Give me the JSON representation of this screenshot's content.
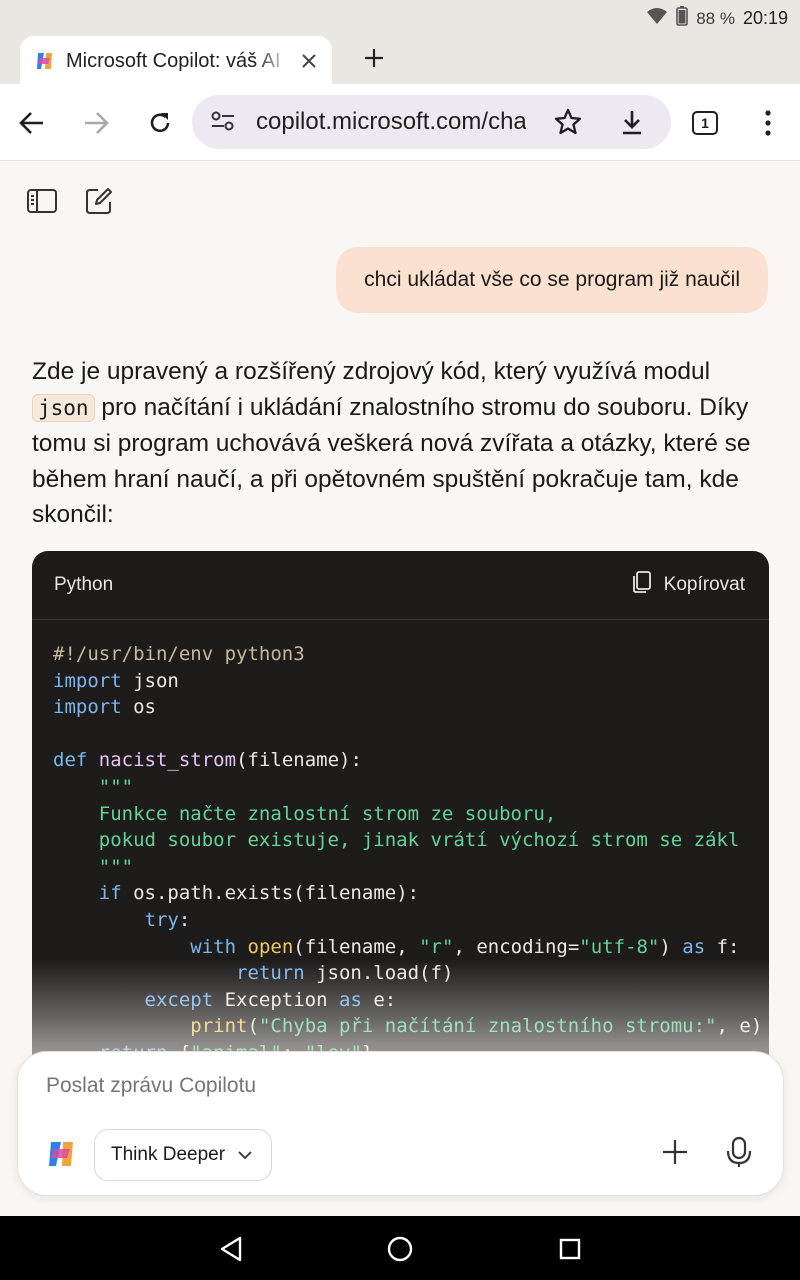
{
  "status_bar": {
    "battery": "88 %",
    "time": "20:19"
  },
  "tab": {
    "title": "Microsoft Copilot: váš AI"
  },
  "toolbar": {
    "url": "copilot.microsoft.com/chats",
    "tab_count": "1"
  },
  "chat": {
    "user_message": "chci ukládat vše co se program již naučil",
    "answer_before_code": "Zde je upravený a rozšířený zdrojový kód, který využívá modul",
    "answer_code_term": "json",
    "answer_after_code": "pro načítání i ukládání znalostního stromu do souboru. Díky tomu si program uchovává veškerá nová zvířata a otázky, které se během hraní naučí, a při opětovném spuštění pokračuje tam, kde skončil:"
  },
  "code_block": {
    "language": "Python",
    "copy_label": "Kopírovat",
    "lines": [
      "#!/usr/bin/env python3",
      "import json",
      "import os",
      "",
      "def nacist_strom(filename):",
      "    \"\"\"",
      "    Funkce načte znalostní strom ze souboru,",
      "    pokud soubor existuje, jinak vrátí výchozí strom se zákl",
      "    \"\"\"",
      "    if os.path.exists(filename):",
      "        try:",
      "            with open(filename, \"r\", encoding=\"utf-8\") as f:",
      "                return json.load(f)",
      "        except Exception as e:",
      "            print(\"Chyba při načítání znalostního stromu:\", e)",
      "    return {\"animal\": \"lev\"}"
    ]
  },
  "composer": {
    "placeholder": "Poslat zprávu Copilotu",
    "mode_label": "Think Deeper"
  },
  "icons": [
    "wifi-icon",
    "battery-icon",
    "copilot-logo-icon",
    "close-icon",
    "plus-icon",
    "back-icon",
    "forward-icon",
    "reload-icon",
    "site-settings-icon",
    "star-icon",
    "download-icon",
    "menu-icon",
    "sidebar-icon",
    "new-chat-icon",
    "copy-icon",
    "chevron-down-icon",
    "mic-icon",
    "nav-back-icon",
    "nav-home-icon",
    "nav-recents-icon"
  ]
}
